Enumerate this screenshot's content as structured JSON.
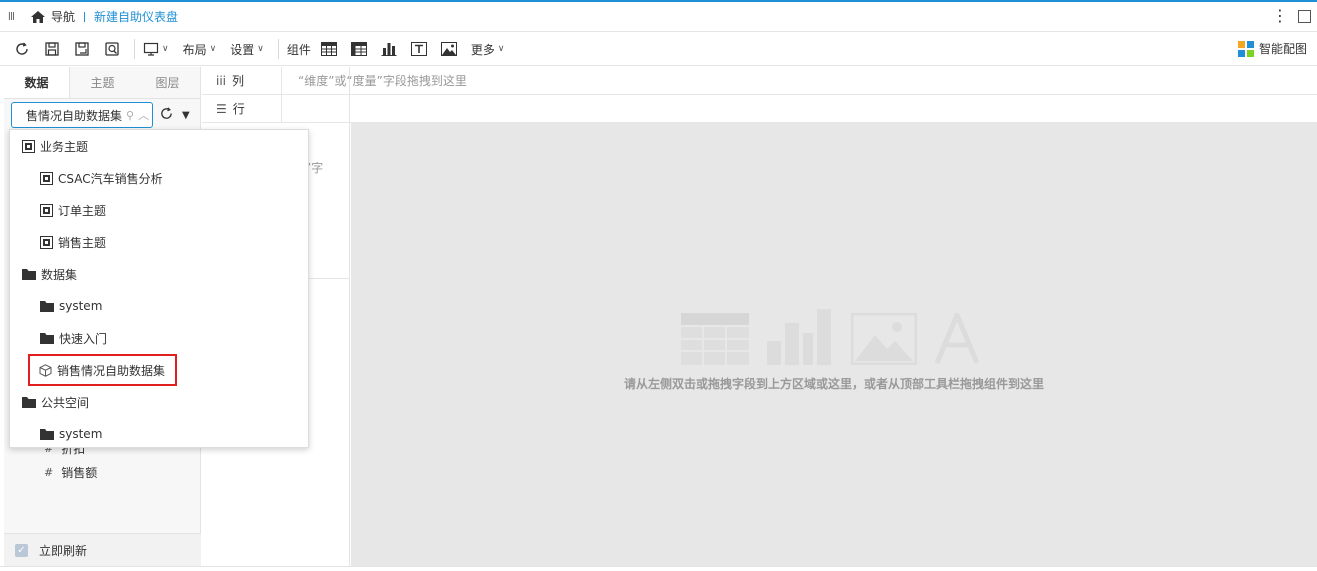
{
  "titlebar": {
    "nav_label": "导航",
    "breadcrumb": "新建自助仪表盘"
  },
  "toolbar": {
    "layout_label": "布局",
    "settings_label": "设置",
    "components_label": "组件",
    "more_label": "更多",
    "smart_label": "智能配图"
  },
  "left_panel": {
    "tabs": [
      "数据",
      "主题",
      "图层"
    ],
    "dataset_select_value": "售情况自助数据集",
    "fields": [
      {
        "icon": "#",
        "label": "折扣"
      },
      {
        "icon": "#",
        "label": "销售额"
      }
    ],
    "auto_refresh_label": "立即刷新"
  },
  "dimension_panel": {
    "partial_hint": "”字"
  },
  "shelves": {
    "columns_label": "列",
    "rows_label": "行",
    "placeholder": "“维度”或“度量”字段拖拽到这里"
  },
  "canvas": {
    "hint": "请从左侧双击或拖拽字段到上方区域或这里，或者从顶部工具栏拖拽组件到这里"
  },
  "dropdown": {
    "items": [
      {
        "label": "业务主题",
        "icon": "subject-icon",
        "level": 0
      },
      {
        "label": "CSAC汽车销售分析",
        "icon": "subject-icon",
        "level": 1
      },
      {
        "label": "订单主题",
        "icon": "subject-icon",
        "level": 1
      },
      {
        "label": "销售主题",
        "icon": "subject-icon",
        "level": 1
      },
      {
        "label": "数据集",
        "icon": "folder-icon",
        "level": 0
      },
      {
        "label": "system",
        "icon": "folder-icon",
        "level": 1
      },
      {
        "label": "快速入门",
        "icon": "folder-icon",
        "level": 1
      },
      {
        "label": "销售情况自助数据集",
        "icon": "cube-icon",
        "level": 1,
        "highlighted": true
      },
      {
        "label": "公共空间",
        "icon": "folder-icon",
        "level": 0
      },
      {
        "label": "system",
        "icon": "folder-icon",
        "level": 1
      }
    ]
  },
  "colors": {
    "accent": "#1f8fd6",
    "highlight_border": "#e02020",
    "canvas_bg": "#e7e7e7"
  }
}
